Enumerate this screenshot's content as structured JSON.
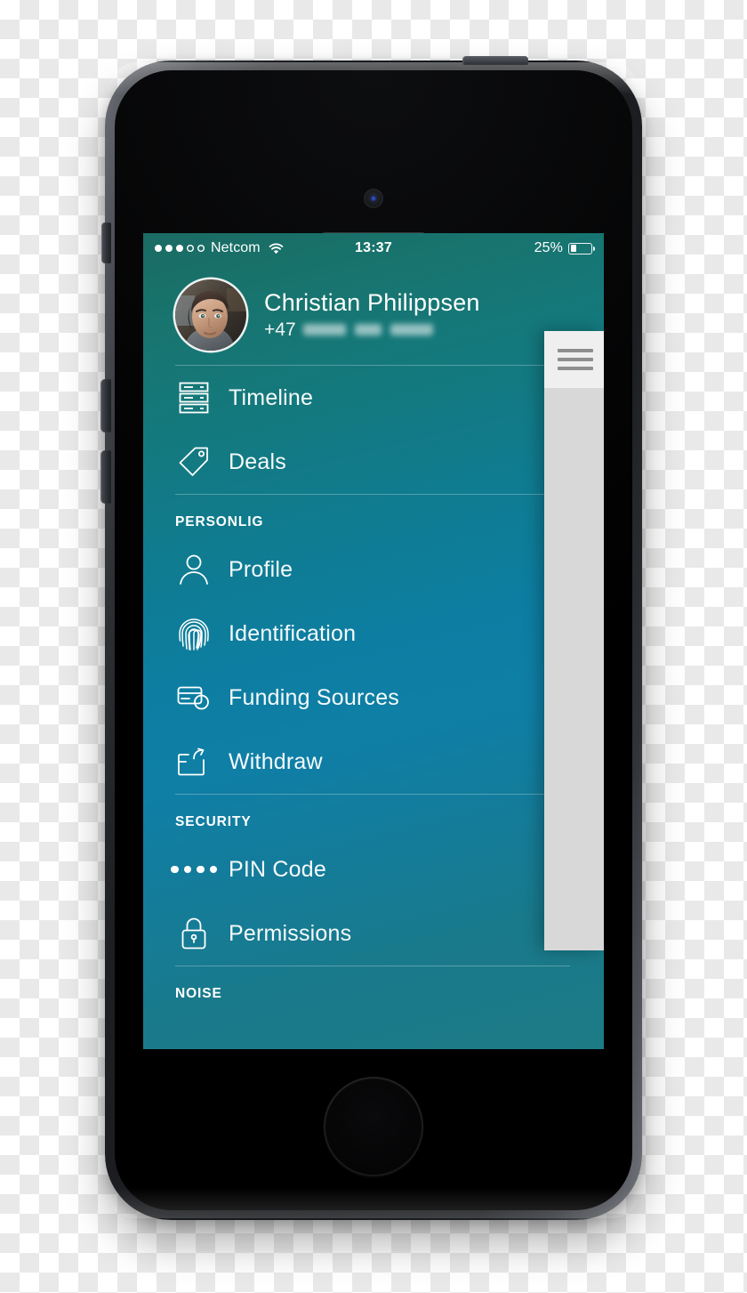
{
  "device": {
    "name": "iPhone 5s",
    "color": "space-gray",
    "hardware": {
      "front_camera": "front-camera",
      "earpiece_speaker": "earpiece-speaker",
      "home_button": "home-button",
      "mute_switch": "mute-switch",
      "volume_up": "volume-up-button",
      "volume_down": "volume-down-button",
      "power_button": "power-button"
    }
  },
  "status_bar": {
    "signal_dots_filled": 3,
    "signal_dots_total": 5,
    "carrier": "Netcom",
    "wifi_icon": "wifi-icon",
    "time": "13:37",
    "battery_percent": "25%",
    "battery_level": 25
  },
  "profile": {
    "avatar_icon": "user-avatar-photo",
    "name": "Christian Philippsen",
    "phone_prefix": "+47",
    "phone_redacted": true
  },
  "menu": {
    "top_items": [
      {
        "label": "Timeline",
        "icon": "timeline-icon"
      },
      {
        "label": "Deals",
        "icon": "tag-icon"
      }
    ],
    "sections": [
      {
        "header": "PERSONLIG",
        "items": [
          {
            "label": "Profile",
            "icon": "person-icon"
          },
          {
            "label": "Identification",
            "icon": "fingerprint-icon"
          },
          {
            "label": "Funding Sources",
            "icon": "credit-card-icon"
          },
          {
            "label": "Withdraw",
            "icon": "withdraw-icon"
          }
        ]
      },
      {
        "header": "SECURITY",
        "items": [
          {
            "label": "PIN Code",
            "icon": "pin-dots-icon"
          },
          {
            "label": "Permissions",
            "icon": "padlock-icon"
          }
        ]
      },
      {
        "header": "NOISE",
        "items": []
      }
    ]
  },
  "content_panel": {
    "menu_button_icon": "hamburger-menu-icon"
  },
  "colors": {
    "screen_gradient_top": "#1a6b63",
    "screen_gradient_mid": "#0d7ea2",
    "screen_gradient_bottom": "#1d7b85",
    "panel_navbar": "#efefef",
    "panel_body": "#d8d8d8",
    "hamburger_bars": "#8e8e8e",
    "text": "#ffffff"
  }
}
